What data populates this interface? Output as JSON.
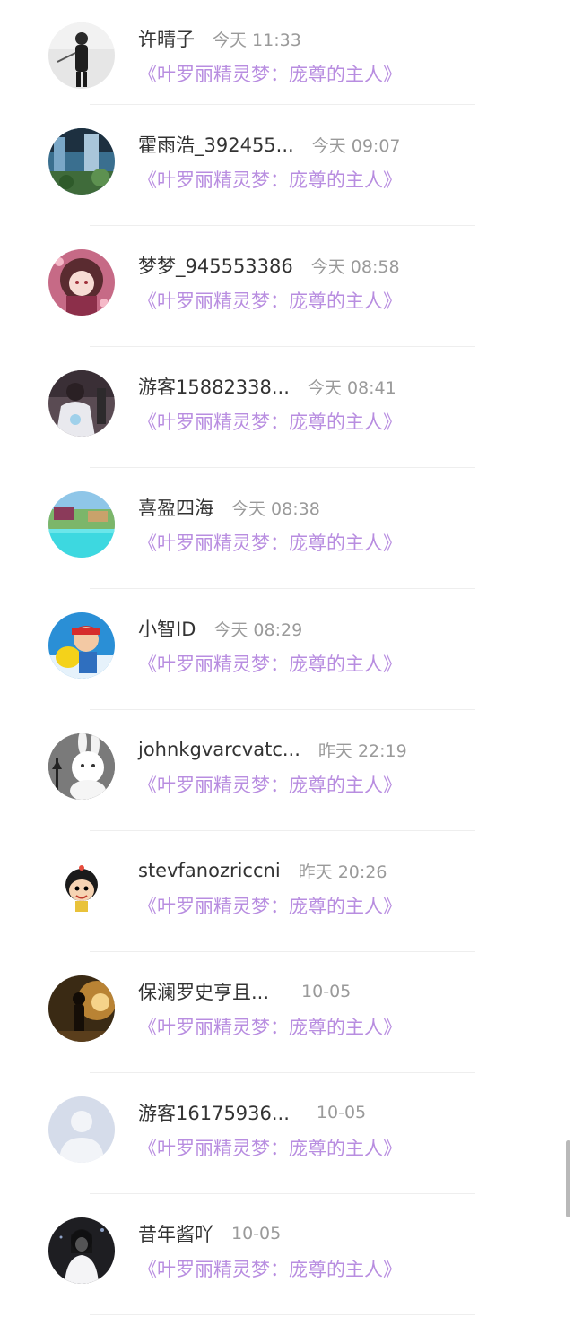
{
  "book_title": "《叶罗丽精灵梦：庞尊的主人》",
  "items": [
    {
      "username": "许晴子",
      "time": "今天 11:33"
    },
    {
      "username": "霍雨浩_392455...",
      "time": "今天 09:07"
    },
    {
      "username": "梦梦_945553386",
      "time": "今天 08:58"
    },
    {
      "username": "游客15882338...",
      "time": "今天 08:41"
    },
    {
      "username": "喜盈四海",
      "time": "今天 08:38"
    },
    {
      "username": "小智ID",
      "time": "今天 08:29"
    },
    {
      "username": "johnkgvarcvatc...",
      "time": "昨天 22:19"
    },
    {
      "username": "stevfanozriccni",
      "time": "昨天 20:26"
    },
    {
      "username": "保澜罗史亨且...",
      "time": "10-05"
    },
    {
      "username": "游客16175936...",
      "time": "10-05"
    },
    {
      "username": "昔年酱吖",
      "time": "10-05"
    }
  ]
}
